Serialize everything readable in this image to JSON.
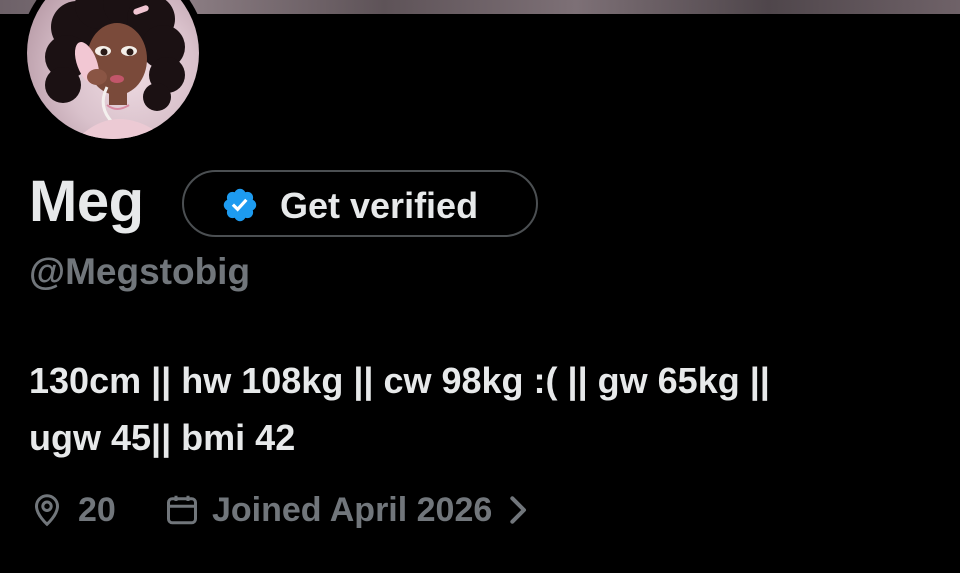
{
  "profile": {
    "name": "Meg",
    "handle": "@Megstobig",
    "bio_line1": "130cm || hw 108kg || cw 98kg :( || gw 65kg ||",
    "bio_line2": "ugw 45|| bmi 42",
    "location": "20",
    "joined": "Joined April 2026"
  },
  "verify_button": {
    "label": "Get verified"
  },
  "icons": {
    "avatar": "avatar",
    "verified": "verified-badge-icon",
    "location": "location-pin-icon",
    "calendar": "calendar-icon",
    "chevron": "chevron-right-icon"
  },
  "colors": {
    "background": "#000000",
    "text_primary": "#e7e9ea",
    "text_secondary": "#71767b",
    "verified_blue": "#1d9bf0",
    "button_border": "#4b4f52"
  }
}
